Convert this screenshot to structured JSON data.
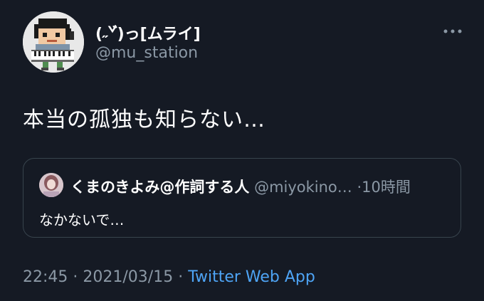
{
  "author": {
    "display_name": "(˶ˇ゙)っ[ムライ]",
    "handle": "@mu_station",
    "avatar_icon": "pixel-art-avatar-icon"
  },
  "menu": {
    "more_icon": "more-icon"
  },
  "tweet": {
    "text": "本当の孤独も知らない…"
  },
  "quote": {
    "display_name": "くまのきよみ@作詞する人",
    "handle": "@miyokino…",
    "dot": "·",
    "time": "10時間",
    "text": "なかないで…"
  },
  "meta": {
    "time": "22:45",
    "sep1": " · ",
    "date": "2021/03/15",
    "sep2": " · ",
    "source": "Twitter Web App"
  },
  "colors": {
    "background": "#151a24",
    "secondary_text": "#8b98a5",
    "link": "#4ea4f5",
    "border": "#38444d"
  }
}
